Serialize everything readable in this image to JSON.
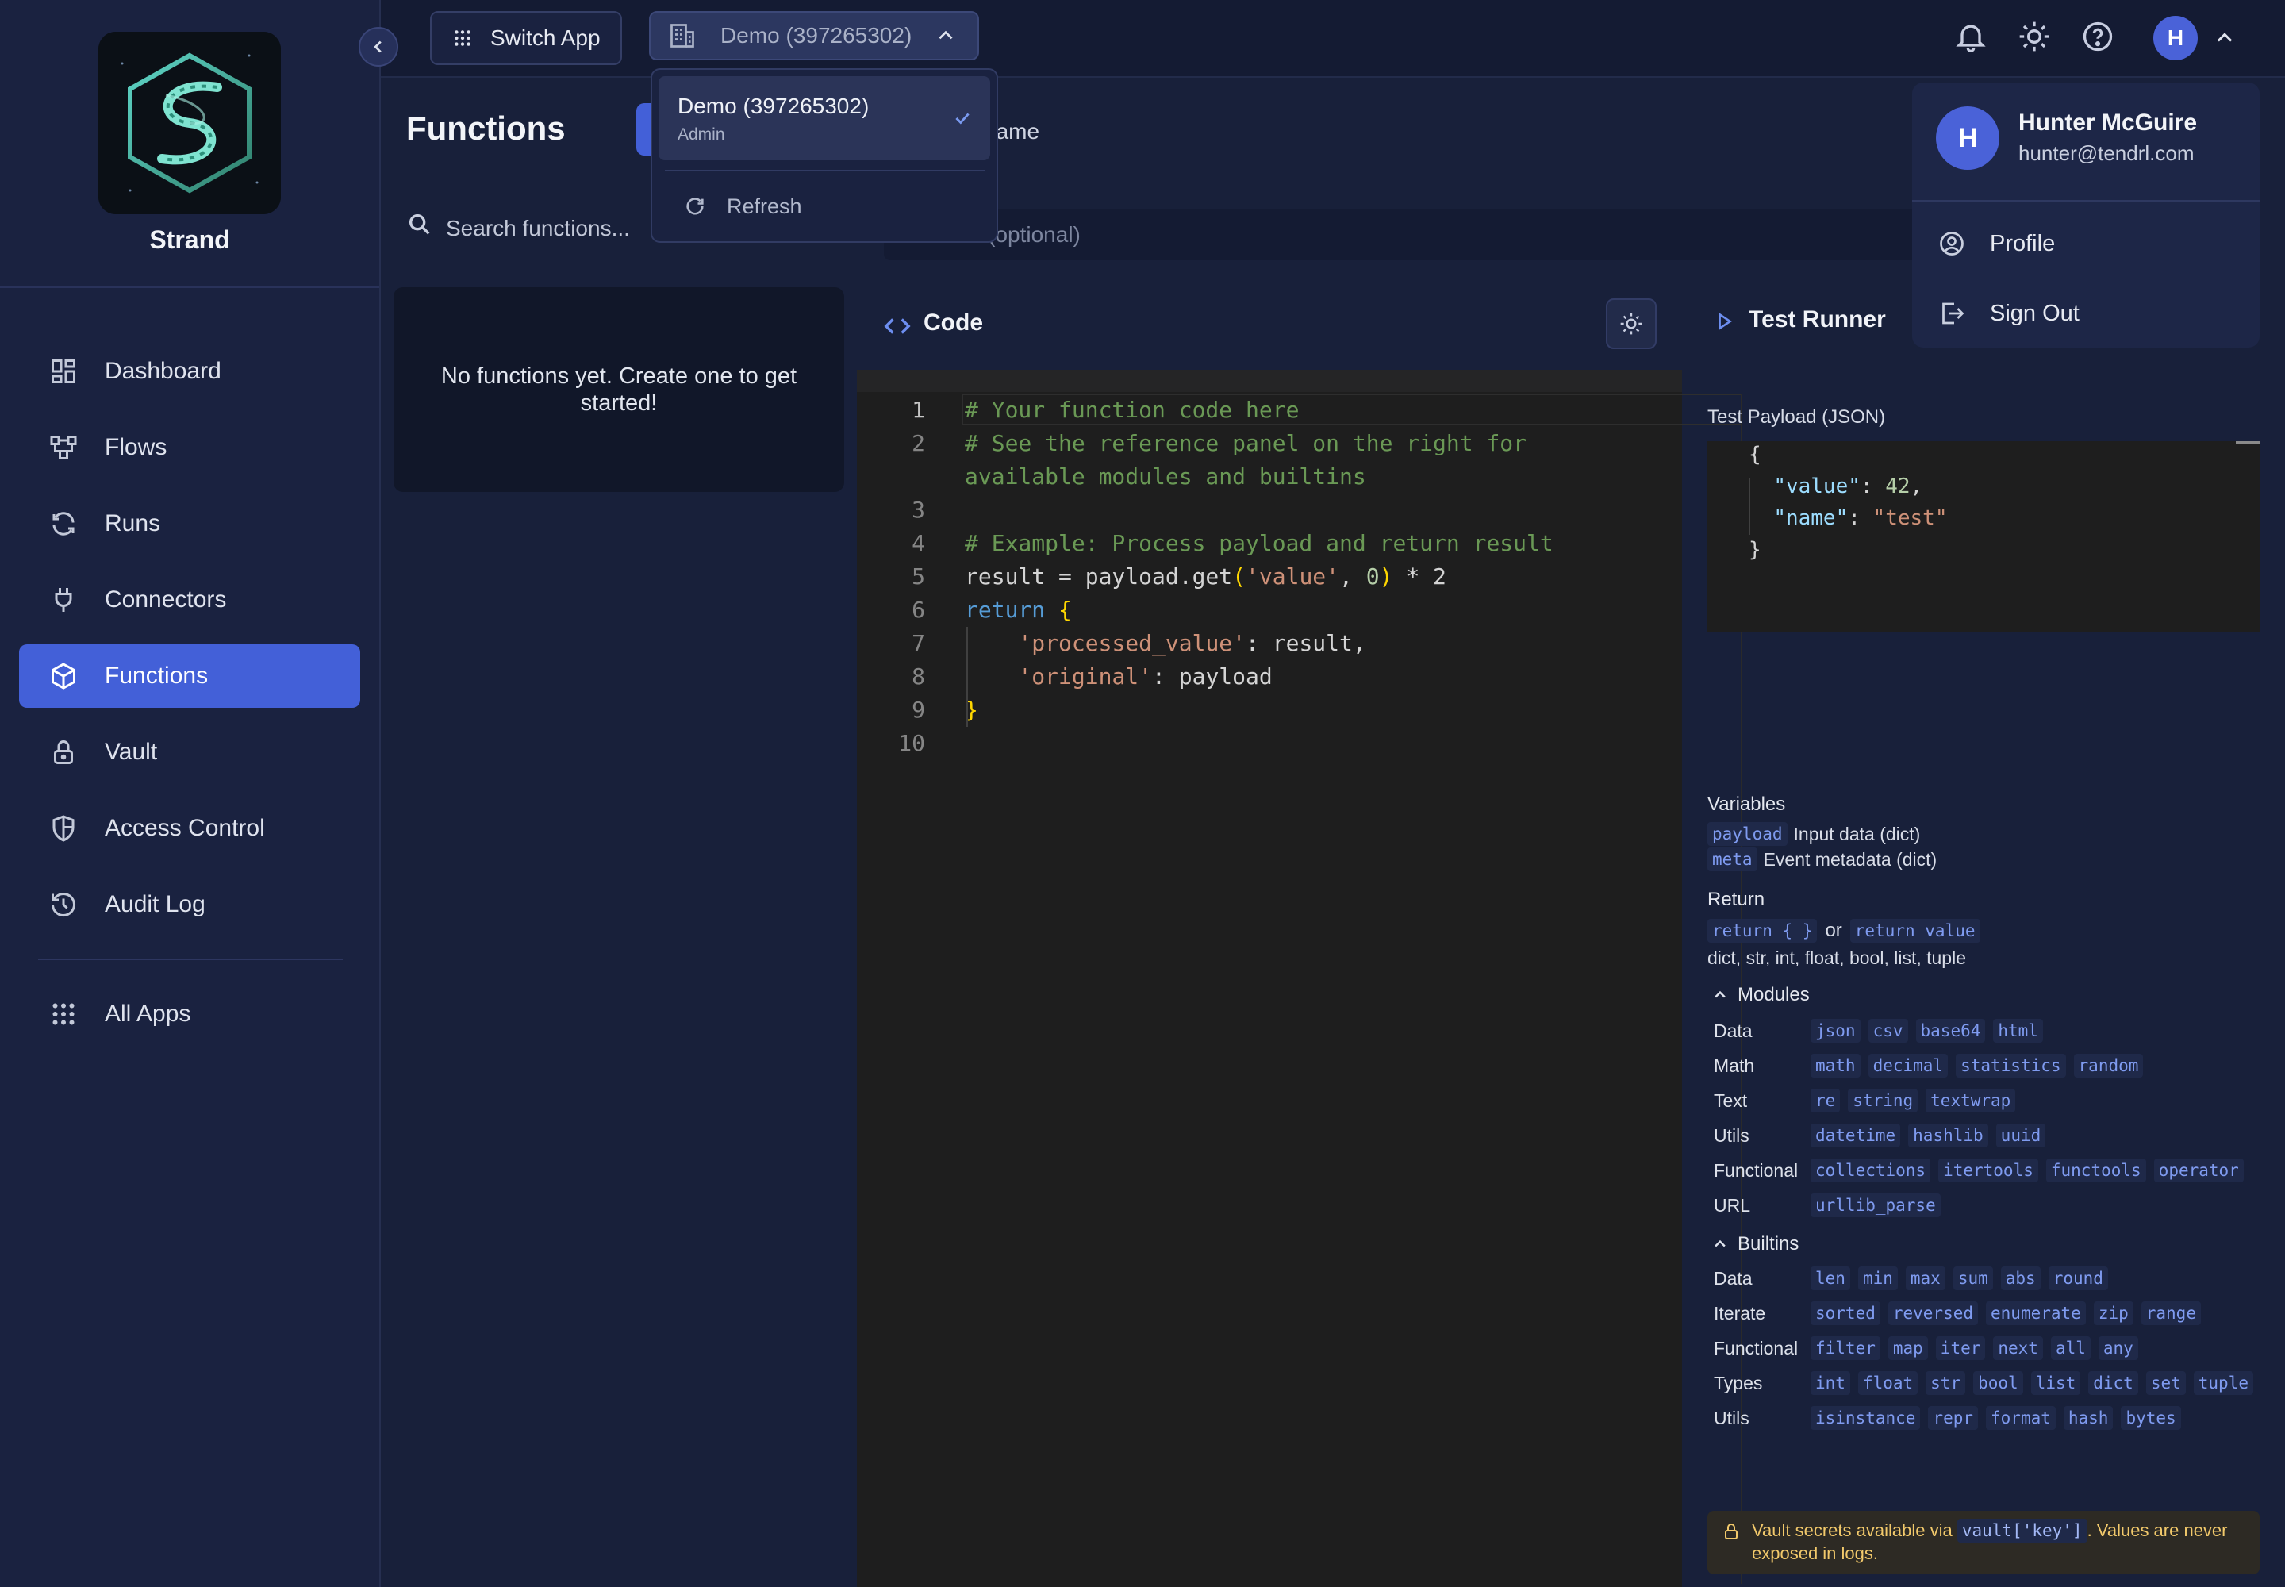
{
  "brand": {
    "name": "Strand"
  },
  "sidebar": {
    "items": [
      {
        "label": "Dashboard",
        "icon": "dashboard-icon"
      },
      {
        "label": "Flows",
        "icon": "flows-icon"
      },
      {
        "label": "Runs",
        "icon": "runs-icon"
      },
      {
        "label": "Connectors",
        "icon": "plug-icon"
      },
      {
        "label": "Functions",
        "icon": "cube-icon",
        "active": true
      },
      {
        "label": "Vault",
        "icon": "lock-icon"
      },
      {
        "label": "Access Control",
        "icon": "shield-icon"
      },
      {
        "label": "Audit Log",
        "icon": "history-icon"
      }
    ],
    "all_apps": "All Apps"
  },
  "topbar": {
    "switch_app": "Switch App",
    "org_selected": "Demo (397265302)",
    "avatar_initial": "H"
  },
  "org_dropdown": {
    "option_name": "Demo (397265302)",
    "option_role": "Admin",
    "refresh": "Refresh"
  },
  "user_menu": {
    "initial": "H",
    "name": "Hunter McGuire",
    "email": "hunter@tendrl.com",
    "profile": "Profile",
    "sign_out": "Sign Out"
  },
  "main": {
    "title": "Functions",
    "name_label_fragment": "name",
    "search_placeholder": "Search functions...",
    "description_placeholder": "ion (optional)",
    "empty_text": "No functions yet. Create one to get started!"
  },
  "code_panel": {
    "title": "Code",
    "line_numbers": [
      "1",
      "2",
      "3",
      "4",
      "5",
      "6",
      "7",
      "8",
      "9",
      "10"
    ],
    "lines": [
      "# Your function code here",
      "# See the reference panel on the right for",
      "available modules and builtins",
      "",
      "# Example: Process payload and return result",
      "result = payload.get('value', 0) * 2",
      "return {",
      "    'processed_value': result,",
      "    'original': payload",
      "}"
    ]
  },
  "test_runner": {
    "title": "Test Runner",
    "payload_label": "Test Payload (JSON)",
    "payload_lines": [
      "{",
      "  \"value\": 42,",
      "  \"name\": \"test\"",
      "}"
    ]
  },
  "reference": {
    "variables_title": "Variables",
    "variables": [
      {
        "token": "payload",
        "desc": "Input data (dict)"
      },
      {
        "token": "meta",
        "desc": "Event metadata (dict)"
      }
    ],
    "return_title": "Return",
    "return_token_1": "return { }",
    "return_or": "or",
    "return_token_2": "return value",
    "return_types": "dict, str, int, float, bool, list, tuple",
    "modules_title": "Modules",
    "modules": [
      {
        "label": "Data",
        "tokens": [
          "json",
          "csv",
          "base64",
          "html"
        ]
      },
      {
        "label": "Math",
        "tokens": [
          "math",
          "decimal",
          "statistics",
          "random"
        ]
      },
      {
        "label": "Text",
        "tokens": [
          "re",
          "string",
          "textwrap"
        ]
      },
      {
        "label": "Utils",
        "tokens": [
          "datetime",
          "hashlib",
          "uuid"
        ]
      },
      {
        "label": "Functional",
        "tokens": [
          "collections",
          "itertools",
          "functools",
          "operator"
        ]
      },
      {
        "label": "URL",
        "tokens": [
          "urllib_parse"
        ]
      }
    ],
    "builtins_title": "Builtins",
    "builtins": [
      {
        "label": "Data",
        "tokens": [
          "len",
          "min",
          "max",
          "sum",
          "abs",
          "round"
        ]
      },
      {
        "label": "Iterate",
        "tokens": [
          "sorted",
          "reversed",
          "enumerate",
          "zip",
          "range"
        ]
      },
      {
        "label": "Functional",
        "tokens": [
          "filter",
          "map",
          "iter",
          "next",
          "all",
          "any"
        ]
      },
      {
        "label": "Types",
        "tokens": [
          "int",
          "float",
          "str",
          "bool",
          "list",
          "dict",
          "set",
          "tuple"
        ]
      },
      {
        "label": "Utils",
        "tokens": [
          "isinstance",
          "repr",
          "format",
          "hash",
          "bytes"
        ]
      }
    ],
    "vault_prefix": "Vault secrets available via",
    "vault_token": "vault['key']",
    "vault_suffix": ". Values are never exposed in logs."
  },
  "colors": {
    "accent": "#4360d8",
    "background": "#18203a",
    "sidebar": "#1a2240",
    "editor": "#1e1e1e",
    "vault_warning": "#f2c96b"
  }
}
